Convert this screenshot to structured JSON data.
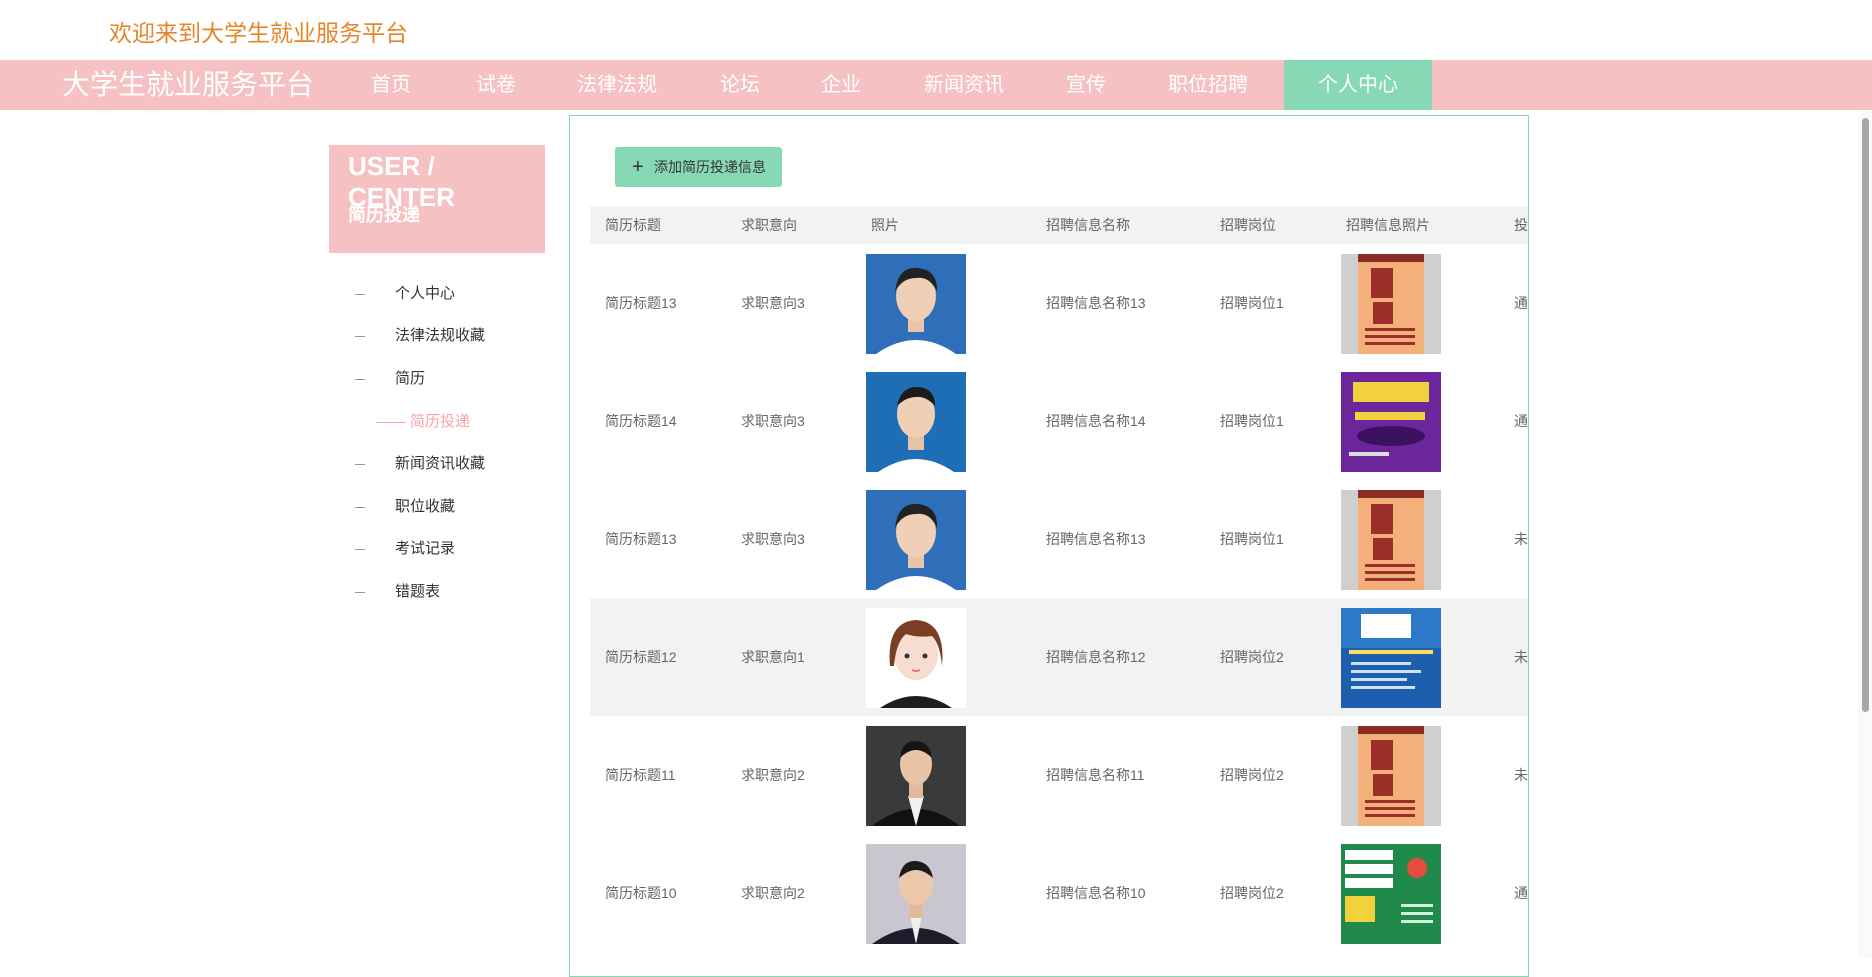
{
  "header": {
    "welcome": "欢迎来到大学生就业服务平台"
  },
  "nav": {
    "brand": "大学生就业服务平台",
    "items": [
      "首页",
      "试卷",
      "法律法规",
      "论坛",
      "企业",
      "新闻资讯",
      "宣传",
      "职位招聘",
      "个人中心"
    ],
    "active": "个人中心"
  },
  "sidebar": {
    "title": "USER / CENTER",
    "subtitle": "简历投递",
    "menu": [
      "个人中心",
      "法律法规收藏",
      "简历",
      "简历投递",
      "新闻资讯收藏",
      "职位收藏",
      "考试记录",
      "错题表"
    ]
  },
  "main": {
    "add_button": "添加简历投递信息",
    "columns": [
      "简历标题",
      "求职意向",
      "照片",
      "招聘信息名称",
      "招聘岗位",
      "招聘信息照片",
      "投"
    ],
    "rows": [
      {
        "title": "简历标题13",
        "intent": "求职意向3",
        "name": "招聘信息名称13",
        "position": "招聘岗位1",
        "status": "通"
      },
      {
        "title": "简历标题14",
        "intent": "求职意向3",
        "name": "招聘信息名称14",
        "position": "招聘岗位1",
        "status": "通"
      },
      {
        "title": "简历标题13",
        "intent": "求职意向3",
        "name": "招聘信息名称13",
        "position": "招聘岗位1",
        "status": "未"
      },
      {
        "title": "简历标题12",
        "intent": "求职意向1",
        "name": "招聘信息名称12",
        "position": "招聘岗位2",
        "status": "未"
      },
      {
        "title": "简历标题11",
        "intent": "求职意向2",
        "name": "招聘信息名称11",
        "position": "招聘岗位2",
        "status": "未"
      },
      {
        "title": "简历标题10",
        "intent": "求职意向2",
        "name": "招聘信息名称10",
        "position": "招聘岗位2",
        "status": "通"
      }
    ]
  },
  "colors": {
    "nav_bg": "#f6c1c3",
    "accent": "#87d9b6",
    "welcome": "#e5862a"
  },
  "icons": [
    "plus-icon"
  ]
}
